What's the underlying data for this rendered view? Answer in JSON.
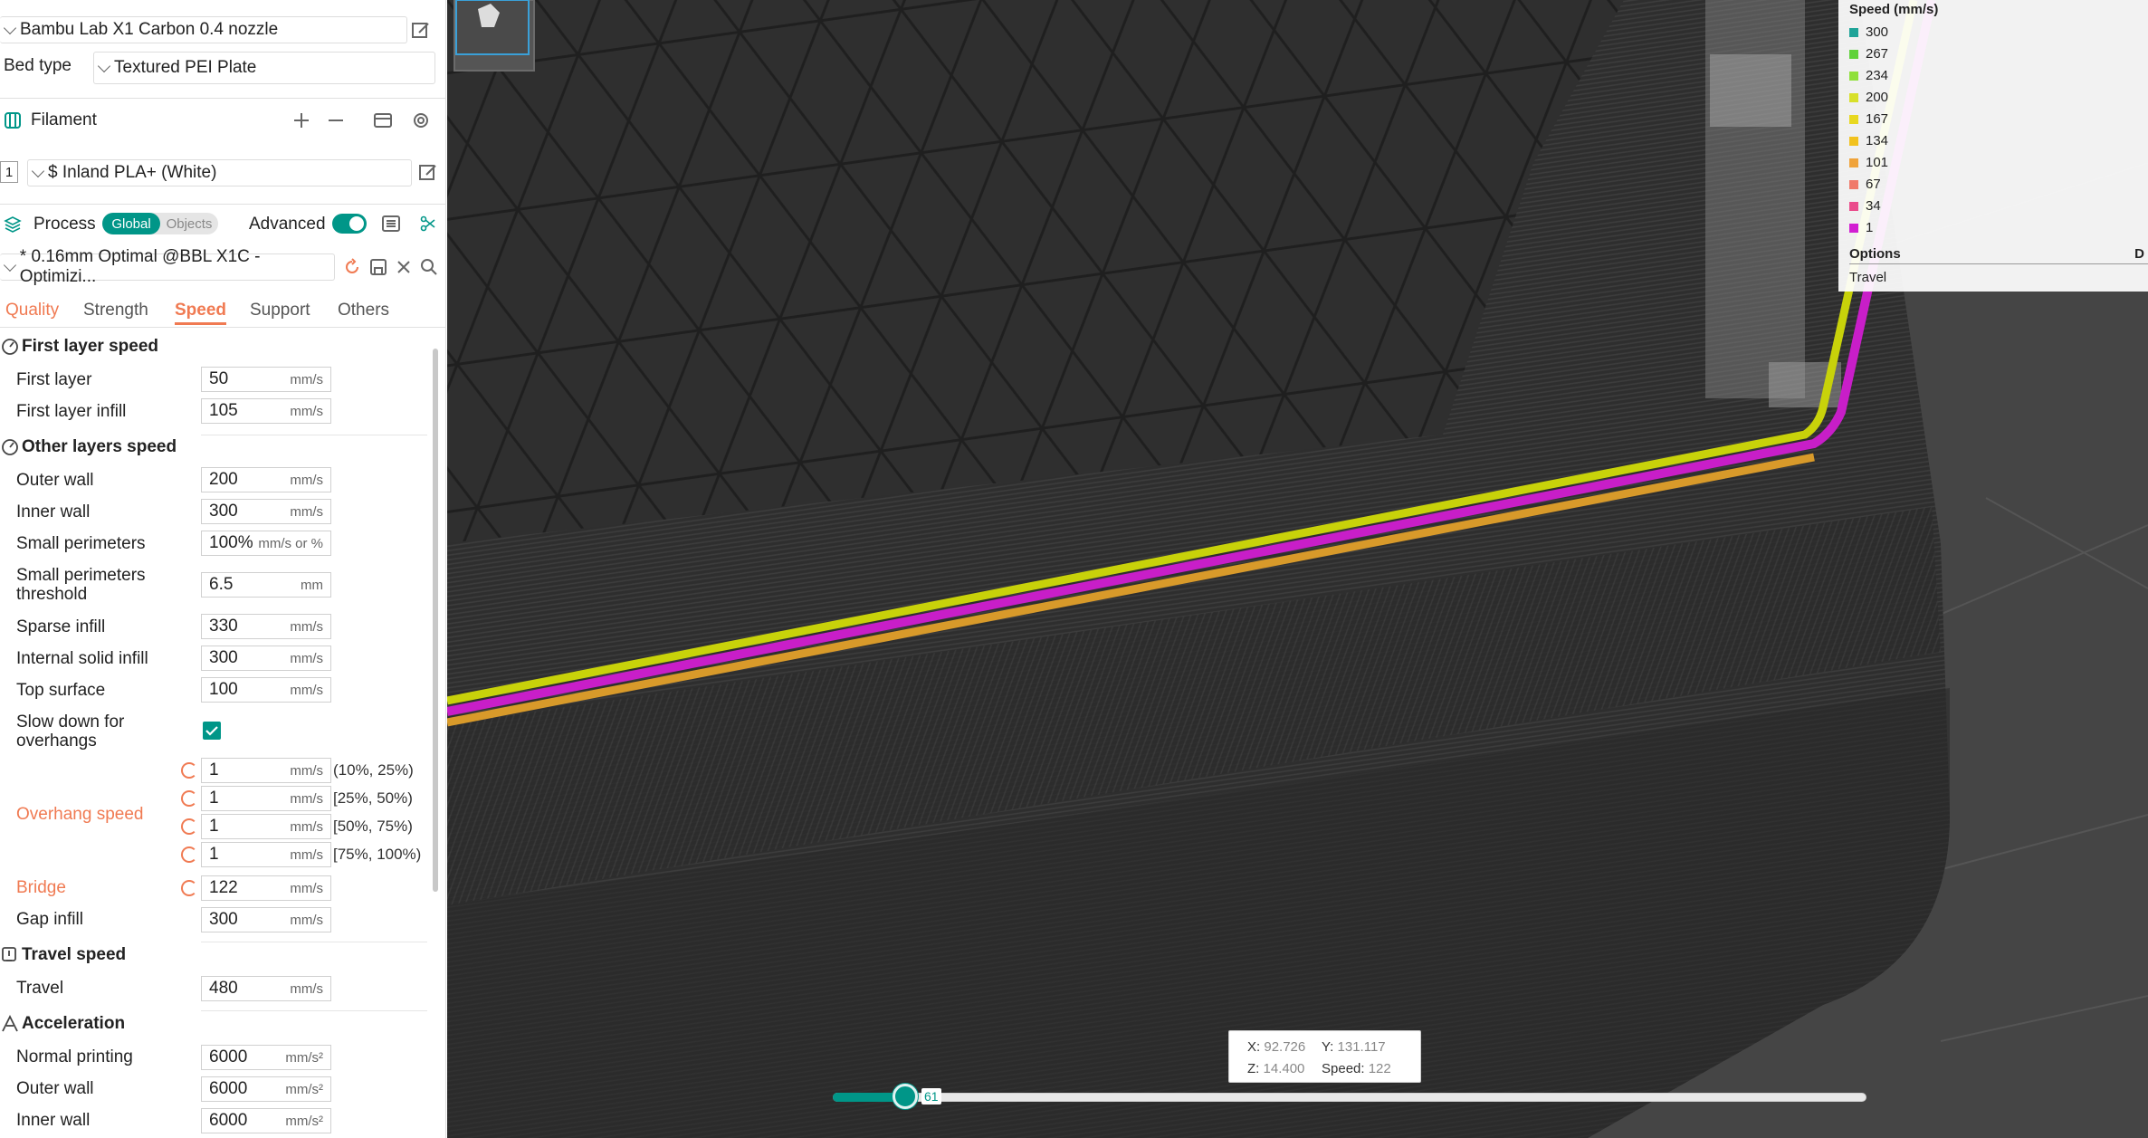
{
  "printer": {
    "name": "Bambu Lab X1 Carbon 0.4 nozzle"
  },
  "bed": {
    "label": "Bed type",
    "value": "Textured PEI Plate"
  },
  "filament": {
    "title": "Filament",
    "index": "1",
    "value": "$ Inland PLA+ (White)"
  },
  "process": {
    "title": "Process",
    "toggle_global": "Global",
    "toggle_objects": "Objects",
    "advanced_label": "Advanced",
    "preset": "* 0.16mm Optimal @BBL X1C - Optimizi..."
  },
  "tabs": [
    "Quality",
    "Strength",
    "Speed",
    "Support",
    "Others"
  ],
  "sections": {
    "first_layer": {
      "title": "First layer speed",
      "rows": [
        {
          "label": "First layer",
          "value": "50",
          "unit": "mm/s"
        },
        {
          "label": "First layer infill",
          "value": "105",
          "unit": "mm/s"
        }
      ]
    },
    "other_layers": {
      "title": "Other layers speed",
      "rows": [
        {
          "label": "Outer wall",
          "value": "200",
          "unit": "mm/s"
        },
        {
          "label": "Inner wall",
          "value": "300",
          "unit": "mm/s"
        },
        {
          "label": "Small perimeters",
          "value": "100%",
          "unit": "mm/s or %"
        },
        {
          "label": "Small perimeters threshold",
          "value": "6.5",
          "unit": "mm"
        },
        {
          "label": "Sparse infill",
          "value": "330",
          "unit": "mm/s"
        },
        {
          "label": "Internal solid infill",
          "value": "300",
          "unit": "mm/s"
        },
        {
          "label": "Top surface",
          "value": "100",
          "unit": "mm/s"
        }
      ],
      "slowdown_label": "Slow down for overhangs",
      "overhang_label": "Overhang speed",
      "overhang": [
        {
          "value": "1",
          "unit": "mm/s",
          "range": "(10%, 25%)"
        },
        {
          "value": "1",
          "unit": "mm/s",
          "range": "[25%, 50%)"
        },
        {
          "value": "1",
          "unit": "mm/s",
          "range": "[50%, 75%)"
        },
        {
          "value": "1",
          "unit": "mm/s",
          "range": "[75%, 100%)"
        }
      ],
      "bridge": {
        "label": "Bridge",
        "value": "122",
        "unit": "mm/s"
      },
      "gap": {
        "label": "Gap infill",
        "value": "300",
        "unit": "mm/s"
      }
    },
    "travel": {
      "title": "Travel speed",
      "rows": [
        {
          "label": "Travel",
          "value": "480",
          "unit": "mm/s"
        }
      ]
    },
    "accel": {
      "title": "Acceleration",
      "rows": [
        {
          "label": "Normal printing",
          "value": "6000",
          "unit": "mm/s²"
        },
        {
          "label": "Outer wall",
          "value": "6000",
          "unit": "mm/s²"
        },
        {
          "label": "Inner wall",
          "value": "6000",
          "unit": "mm/s²"
        }
      ]
    }
  },
  "legend": {
    "title": "Speed (mm/s)",
    "items": [
      {
        "value": "300",
        "color": "#1fa398"
      },
      {
        "value": "267",
        "color": "#5fd23a"
      },
      {
        "value": "234",
        "color": "#8fe03a"
      },
      {
        "value": "200",
        "color": "#d8e02a"
      },
      {
        "value": "167",
        "color": "#e8d820"
      },
      {
        "value": "134",
        "color": "#f2c21e"
      },
      {
        "value": "101",
        "color": "#f0a33a"
      },
      {
        "value": "67",
        "color": "#f07a6a"
      },
      {
        "value": "34",
        "color": "#ea4c8c"
      },
      {
        "value": "1",
        "color": "#d21ed2"
      }
    ],
    "options_label": "Options",
    "options_extra": "D",
    "travel_label": "Travel"
  },
  "coords": {
    "x_label": "X:",
    "x": "92.726",
    "y_label": "Y:",
    "y": "131.117",
    "z_label": "Z:",
    "z": "14.400",
    "speed_label": "Speed:",
    "speed": "122"
  },
  "layer_slider": {
    "value": "61",
    "fraction": 0.07
  },
  "colors": {
    "accent": "#009688",
    "modified": "#f07a52",
    "path_yellow": "#c8d20a",
    "path_magenta": "#c81ec8",
    "path_orange": "#d89a2a"
  }
}
